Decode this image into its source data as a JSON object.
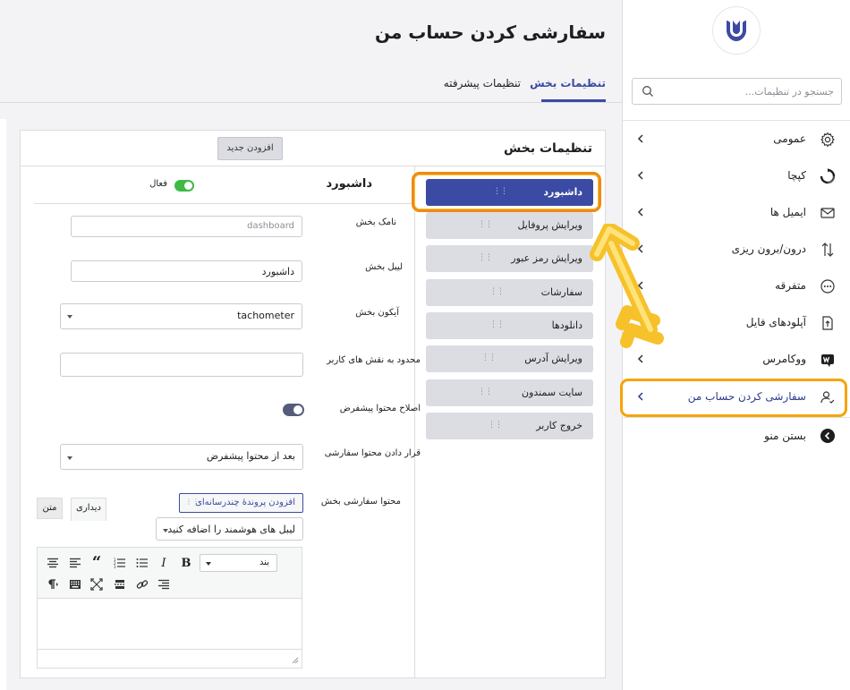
{
  "page": {
    "title": "سفارشی کردن حساب من",
    "tabs": [
      "تنظیمات بخش",
      "تنظیمات پیشرفته"
    ]
  },
  "sidebar": {
    "search_placeholder": "جستجو در تنظیمات...",
    "items": [
      {
        "label": "عمومی",
        "icon": "gear-icon"
      },
      {
        "label": "کپچا",
        "icon": "captcha-icon"
      },
      {
        "label": "ایمیل ها",
        "icon": "envelope-icon"
      },
      {
        "label": "درون/برون ریزی",
        "icon": "import-export-icon"
      },
      {
        "label": "متفرقه",
        "icon": "ellipsis-circle-icon"
      },
      {
        "label": "آپلودهای فایل",
        "icon": "file-upload-icon"
      },
      {
        "label": "ووکامرس",
        "icon": "woocommerce-icon"
      },
      {
        "label": "سفارشی کردن حساب من",
        "icon": "user-check-icon"
      }
    ],
    "close_menu": "بستن منو"
  },
  "panel": {
    "title": "تنظیمات بخش",
    "add_new": "افزودن جدید",
    "sections": [
      "داشبورد",
      "ویرایش پروفایل",
      "ویرایش رمز عبور",
      "سفارشات",
      "دانلودها",
      "ویرایش آدرس",
      "سایت سمندون",
      "خروج کاربر"
    ],
    "active_section": "داشبورد"
  },
  "form": {
    "title": "داشبورد",
    "active_label": "فعال",
    "section_name_label": "نامک بخش",
    "section_name_placeholder": "dashboard",
    "section_label_label": "لیبل بخش",
    "section_label_value": "داشبورد",
    "section_icon_label": "آیکون بخش",
    "section_icon_value": "tachometer",
    "restrict_roles_label": "محدود به نقش های کاربر",
    "fix_default_label": "اصلاح محتوا پیشفرض",
    "placement_label": "قرار دادن محتوا سفارشی",
    "placement_value": "بعد از محتوا پیشفرض",
    "custom_content_label": "محتوا سفارشی بخش",
    "add_media_button": "افزودن پروندهٔ چندرسانه‌ای",
    "smart_labels_placeholder": "لیبل های هوشمند را اضافه کنید",
    "editor_tab_visual": "دیداری",
    "editor_tab_text": "متن",
    "format_select_value": "بند"
  },
  "colors": {
    "accent": "#3b4aa3",
    "highlight_orange": "#f08a12",
    "highlight_yellow": "#f8c23a",
    "toggle_on": "#3fba45"
  }
}
